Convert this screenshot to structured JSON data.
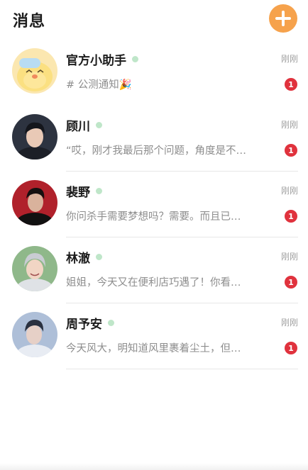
{
  "header": {
    "title": "消息"
  },
  "colors": {
    "accent": "#f6a24c",
    "badge": "#e0323d",
    "online": "#bfe6c9"
  },
  "conversations": [
    {
      "name": "官方小助手",
      "time": "刚刚",
      "preview": "# 公测通知🎉",
      "unread": "1",
      "avatar_icon": "yellow-cat-mascot"
    },
    {
      "name": "顾川",
      "time": "刚刚",
      "preview": "“哎，刚才我最后那个问题，角度是不…",
      "unread": "1",
      "avatar_icon": "dark-hair-man-portrait"
    },
    {
      "name": "裴野",
      "time": "刚刚",
      "preview": "你问杀手需要梦想吗？需要。而且已…",
      "unread": "1",
      "avatar_icon": "red-background-man-portrait"
    },
    {
      "name": "林澈",
      "time": "刚刚",
      "preview": "姐姐，今天又在便利店巧遇了！你看…",
      "unread": "1",
      "avatar_icon": "silver-hair-smiling-man-portrait"
    },
    {
      "name": "周予安",
      "time": "刚刚",
      "preview": "今天风大，明知道风里裹着尘土，但…",
      "unread": "1",
      "avatar_icon": "blue-tone-man-portrait"
    }
  ]
}
